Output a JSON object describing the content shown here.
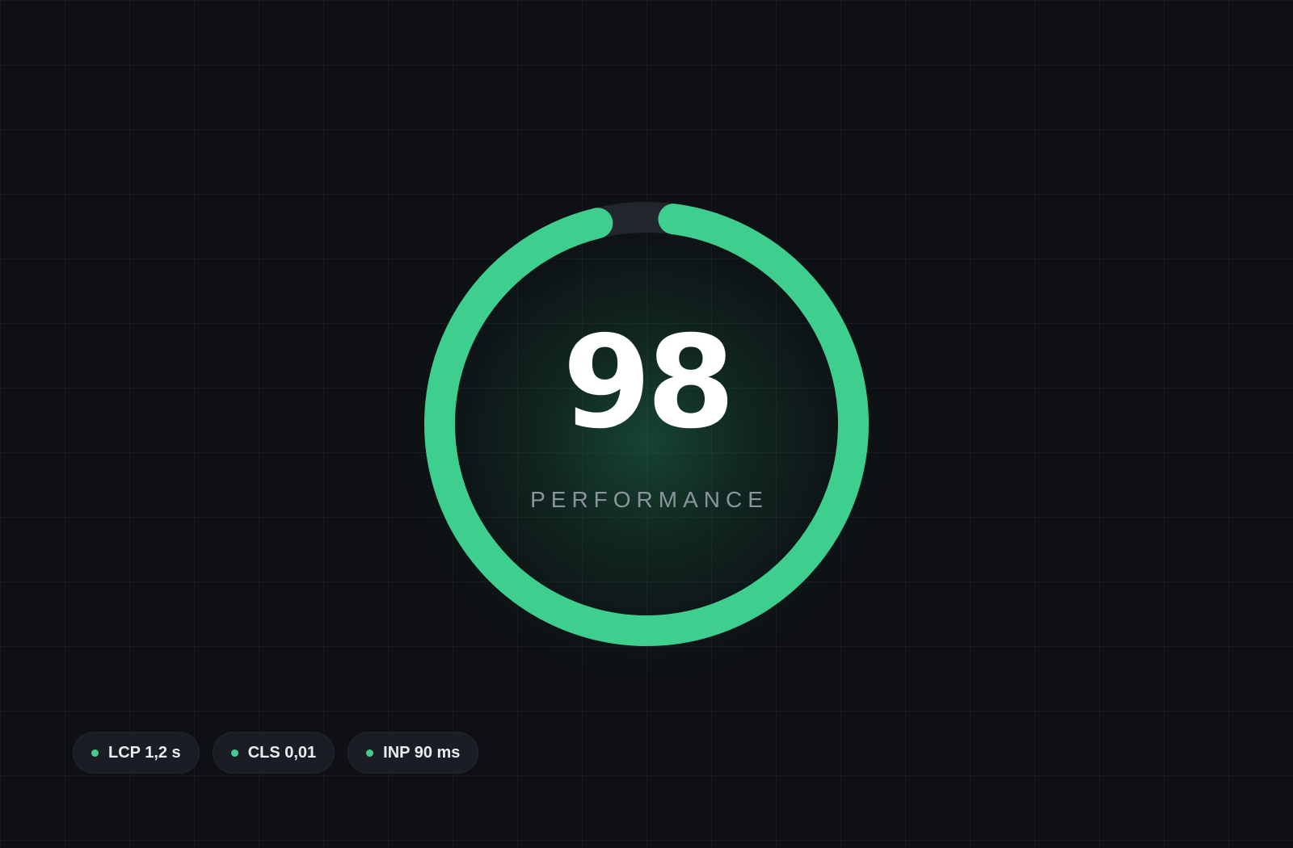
{
  "gauge": {
    "score": "98",
    "label": "PERFORMANCE",
    "fill_fraction": 0.98,
    "accent_color": "#3ecf8e",
    "track_color": "#21252c"
  },
  "metrics": [
    {
      "label": "LCP 1,2 s",
      "status_color": "#3ecf8e"
    },
    {
      "label": "CLS 0,01",
      "status_color": "#3ecf8e"
    },
    {
      "label": "INP 90 ms",
      "status_color": "#3ecf8e"
    }
  ],
  "colors": {
    "background": "#0e1014",
    "chip_background": "#1a1d23"
  }
}
